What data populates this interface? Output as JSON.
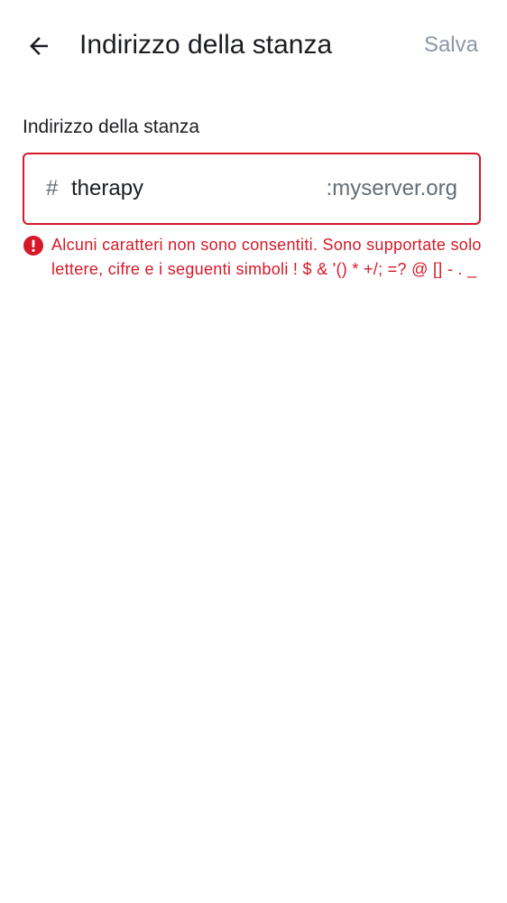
{
  "header": {
    "title": "Indirizzo della stanza",
    "save_label": "Salva",
    "back_icon": "arrow-left-icon"
  },
  "form": {
    "label": "Indirizzo della stanza",
    "prefix": "#",
    "alias_value": "therapy",
    "server_suffix": ":myserver.org",
    "error_icon": "error-icon",
    "error_message": "Alcuni caratteri non sono consentiti. Sono supportate solo lettere, cifre e i seguenti simboli ! $ & '() * +/; =? @ [] - . _"
  },
  "colors": {
    "error": "#d51928",
    "text_primary": "#1b1d22",
    "text_secondary": "#656d77",
    "disabled_action": "#8d97a5"
  }
}
